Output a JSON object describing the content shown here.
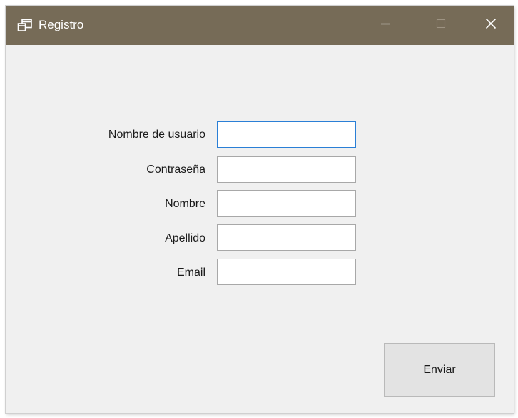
{
  "window": {
    "title": "Registro",
    "app_icon": "windows-form-icon",
    "titlebar_color": "#766b57",
    "controls": {
      "minimize_icon": "minimize-icon",
      "maximize_icon": "maximize-icon",
      "close_icon": "close-icon"
    }
  },
  "form": {
    "fields": [
      {
        "label": "Nombre de usuario",
        "value": ""
      },
      {
        "label": "Contraseña",
        "value": ""
      },
      {
        "label": "Nombre",
        "value": ""
      },
      {
        "label": "Apellido",
        "value": ""
      },
      {
        "label": "Email",
        "value": ""
      }
    ],
    "submit_label": "Enviar",
    "focus_color": "#2a7fd6"
  }
}
